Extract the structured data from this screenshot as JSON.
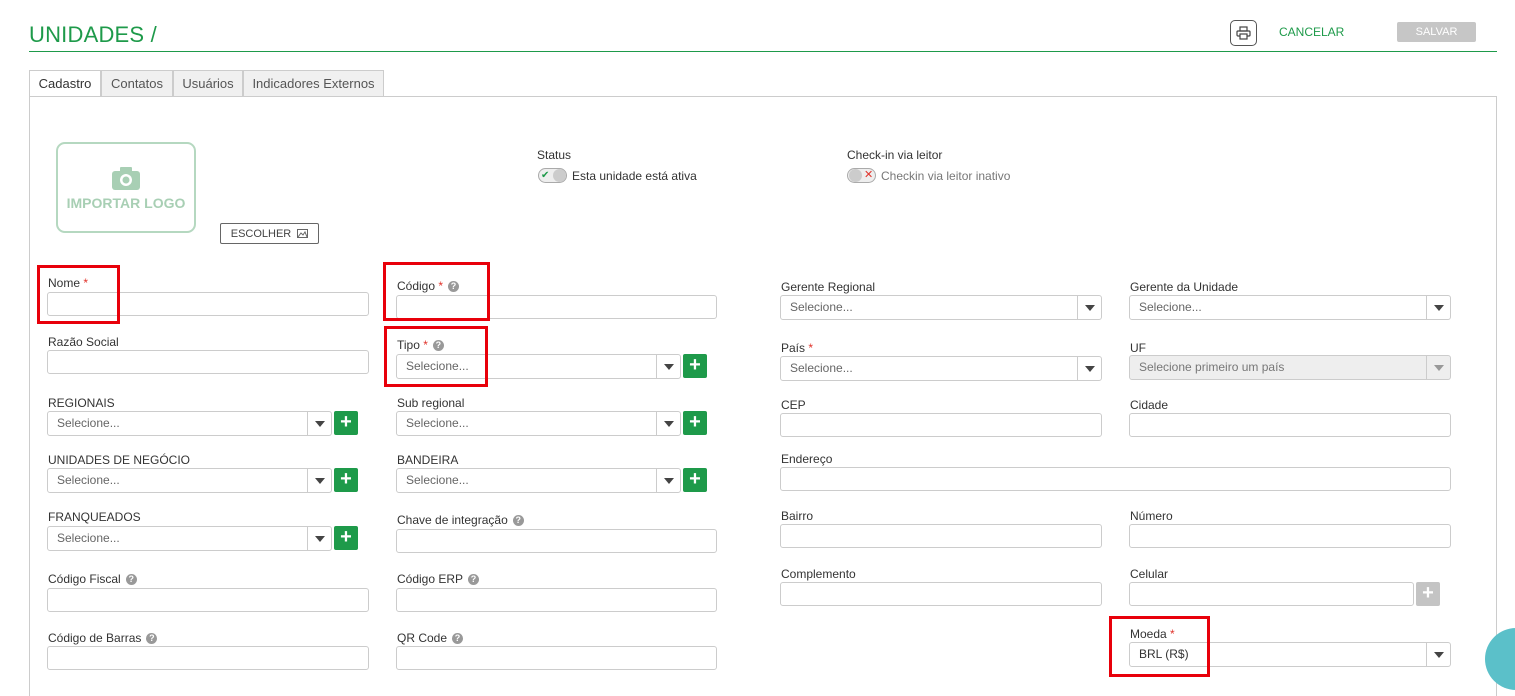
{
  "header": {
    "title": "UNIDADES /",
    "cancel": "CANCELAR",
    "save": "SALVAR"
  },
  "tabs": [
    "Cadastro",
    "Contatos",
    "Usuários",
    "Indicadores Externos"
  ],
  "logo": {
    "label": "IMPORTAR LOGO",
    "choose": "ESCOLHER"
  },
  "status": {
    "label": "Status",
    "toggle_text": "Esta unidade está ativa",
    "state": "on"
  },
  "checkin": {
    "label": "Check-in via leitor",
    "toggle_text": "Checkin via leitor inativo",
    "state": "off"
  },
  "fields": {
    "nome": "Nome",
    "codigo": "Código",
    "razao_social": "Razão Social",
    "tipo": "Tipo",
    "regionais": "REGIONAIS",
    "sub_regional": "Sub regional",
    "unidades_negocio": "UNIDADES DE NEGÓCIO",
    "bandeira": "BANDEIRA",
    "franqueados": "FRANQUEADOS",
    "chave_integracao": "Chave de integração",
    "codigo_fiscal": "Código Fiscal",
    "codigo_erp": "Código ERP",
    "codigo_barras": "Código de Barras",
    "qr_code": "QR Code",
    "gerente_regional": "Gerente Regional",
    "gerente_unidade": "Gerente da Unidade",
    "pais": "País",
    "uf": "UF",
    "cep": "CEP",
    "cidade": "Cidade",
    "endereco": "Endereço",
    "bairro": "Bairro",
    "numero": "Número",
    "complemento": "Complemento",
    "celular": "Celular",
    "moeda": "Moeda"
  },
  "selects": {
    "placeholder": "Selecione...",
    "uf_placeholder": "Selecione primeiro um país",
    "moeda_value": "BRL (R$)"
  },
  "required_mark": "*",
  "help_glyph": "?",
  "colors": {
    "brand": "#1e9a4a",
    "highlight": "#e8000a",
    "required": "#e0332b"
  }
}
